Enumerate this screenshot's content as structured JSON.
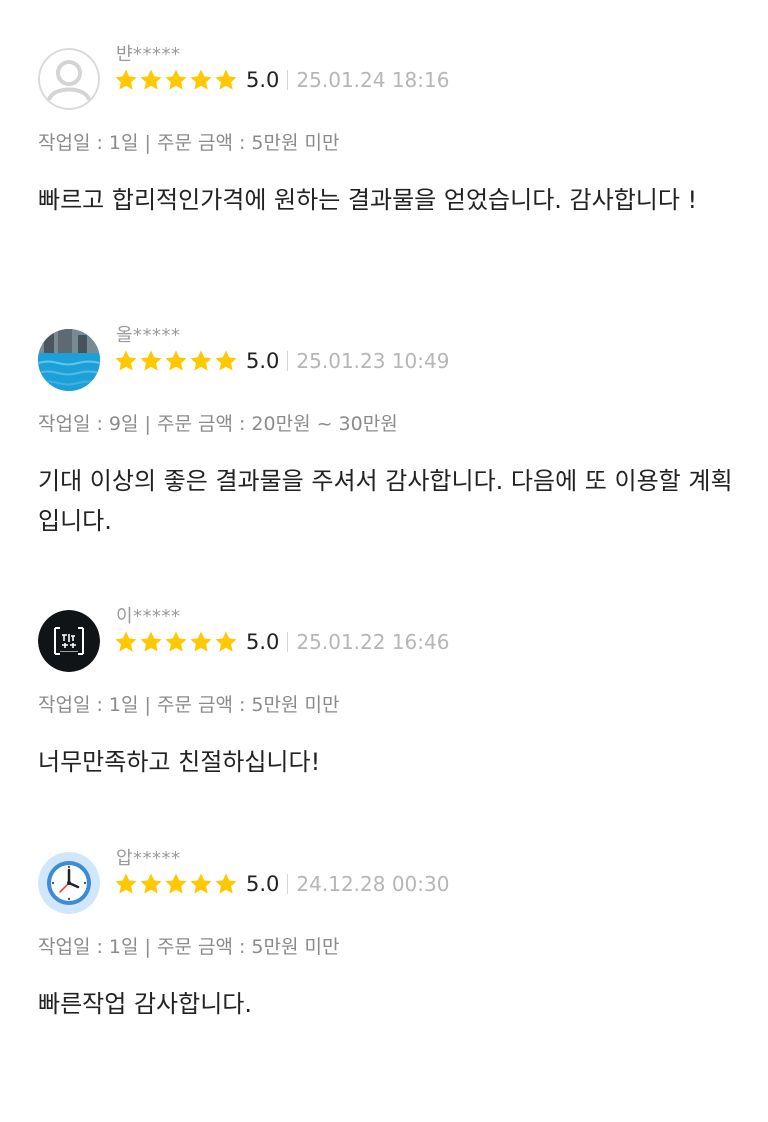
{
  "reviews": [
    {
      "username": "뱐*****",
      "avatar_icon": "default-user-avatar-icon",
      "score": "5.0",
      "date": "25.01.24 18:16",
      "meta": "작업일 : 1일 | 주문 금액 : 5만원 미만",
      "text": "빠르고 합리적인가격에 원하는 결과물을 얻었습니다. 감사합니다 !"
    },
    {
      "username": "올*****",
      "avatar_icon": "pool-photo-avatar-icon",
      "score": "5.0",
      "date": "25.01.23 10:49",
      "meta": "작업일 : 9일 | 주문 금액 : 20만원 ~ 30만원",
      "text": "기대 이상의 좋은 결과물을 주셔서 감사합니다. 다음에 또 이용할 계획입니다."
    },
    {
      "username": "이*****",
      "avatar_icon": "dark-logo-avatar-icon",
      "score": "5.0",
      "date": "25.01.22 16:46",
      "meta": "작업일 : 1일 | 주문 금액 : 5만원 미만",
      "text": "너무만족하고 친절하십니다!"
    },
    {
      "username": "압*****",
      "avatar_icon": "clock-avatar-icon",
      "score": "5.0",
      "date": "24.12.28 00:30",
      "meta": "작업일 : 1일 | 주문 금액 : 5만원 미만",
      "text": "빠른작업 감사합니다."
    }
  ],
  "star_rating": 5,
  "colors": {
    "star": "#FFC800",
    "username": "#9A9A9A",
    "date": "#B6B6B6",
    "meta": "#8B8B8B",
    "text": "#222222"
  }
}
